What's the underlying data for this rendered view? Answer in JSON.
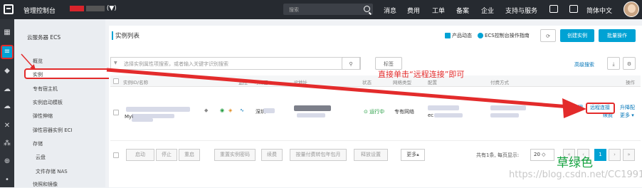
{
  "topbar": {
    "console_label": "管理控制台",
    "region_suffix": "(▼)",
    "search_placeholder": "搜索",
    "nav": [
      "消息",
      "费用",
      "工单",
      "备案",
      "企业",
      "支持与服务",
      "简体中文"
    ]
  },
  "sidebar": {
    "title": "云服务器 ECS",
    "items": [
      "概览",
      "实例",
      "专有宿主机",
      "实例启动模板",
      "弹性伸缩",
      "弹性容器实例 ECI",
      "存储",
      "云盘",
      "文件存储 NAS",
      "快照和镜像"
    ]
  },
  "main": {
    "page_title": "实例列表",
    "product_news": "产品动态",
    "ecs_guide": "ECS控制台操作指南",
    "create_button": "创建实例",
    "batch_button": "批量操作",
    "search_placeholder": "选择实例属性项搜索，或者输入关键字识别搜索",
    "search_help": "?",
    "tag_button": "标签",
    "advanced_search": "高级搜索",
    "columns": [
      "实例ID/名称",
      "监控",
      "可用区",
      "IP地址",
      "状态",
      "网络类型",
      "配置",
      "付费方式",
      "操作"
    ],
    "row": {
      "name_fragment": "Myi",
      "zone": "深圳",
      "status": "运行中",
      "network": "专有网络",
      "config_fragment": "ec",
      "action_manage": "管理",
      "action_remote": "远程连接",
      "action_upgrade": "升降配",
      "action_renew": "续费",
      "action_more": "更多"
    },
    "footer_buttons": [
      "启动",
      "停止",
      "重启",
      "重置实例密码",
      "续费",
      "按量付费转包年包月",
      "释放设置",
      "更多▴"
    ],
    "pager_text": "共有1条, 每页显示:",
    "page_size": "20",
    "pages": [
      "«",
      "‹",
      "1",
      "›",
      "»"
    ]
  },
  "annotation": "直接单击“远程连接”即可",
  "watermark": {
    "green_text": "草绿色",
    "url": "https://blog.csdn.net/CC1991_"
  },
  "colors": {
    "topbar": "#262a30",
    "accent": "#00a2d4",
    "annotation_red": "#e32b2b",
    "status_green": "#1e9a3c"
  }
}
